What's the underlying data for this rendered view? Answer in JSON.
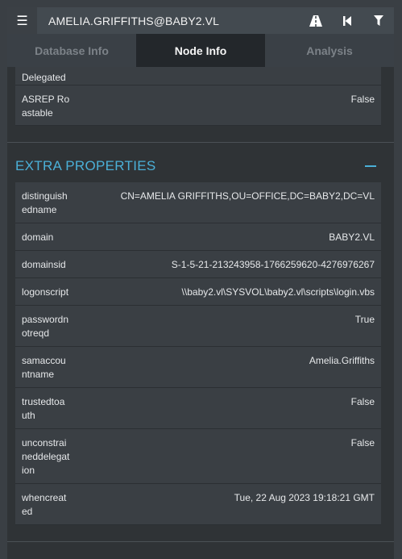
{
  "header": {
    "title": "AMELIA.GRIFFITHS@BABY2.VL"
  },
  "tabs": [
    {
      "label": "Database Info"
    },
    {
      "label": "Node Info"
    },
    {
      "label": "Analysis"
    }
  ],
  "top_rows": [
    {
      "key": "Delegated",
      "value": ""
    },
    {
      "key": "ASREP Roastable",
      "value": "False"
    }
  ],
  "section": {
    "title": "EXTRA PROPERTIES"
  },
  "extra_rows": [
    {
      "key": "distinguishedname",
      "value": "CN=AMELIA GRIFFITHS,OU=OFFICE,DC=BABY2,DC=VL"
    },
    {
      "key": "domain",
      "value": "BABY2.VL"
    },
    {
      "key": "domainsid",
      "value": "S-1-5-21-213243958-1766259620-4276976267"
    },
    {
      "key": "logonscript",
      "value": "\\\\baby2.vl\\SYSVOL\\baby2.vl\\scripts\\login.vbs"
    },
    {
      "key": "passwordnotreqd",
      "value": "True"
    },
    {
      "key": "samaccountname",
      "value": "Amelia.Griffiths"
    },
    {
      "key": "trustedtoauth",
      "value": "False"
    },
    {
      "key": "unconstraineddelegation",
      "value": "False"
    },
    {
      "key": "whencreated",
      "value": "Tue, 22 Aug 2023 19:18:21 GMT"
    }
  ],
  "icons": {
    "menu": "hamburger-icon",
    "road": "road-icon",
    "back": "step-backward-icon",
    "filter": "filter-icon"
  },
  "colors": {
    "accent": "#4bb0d8"
  }
}
